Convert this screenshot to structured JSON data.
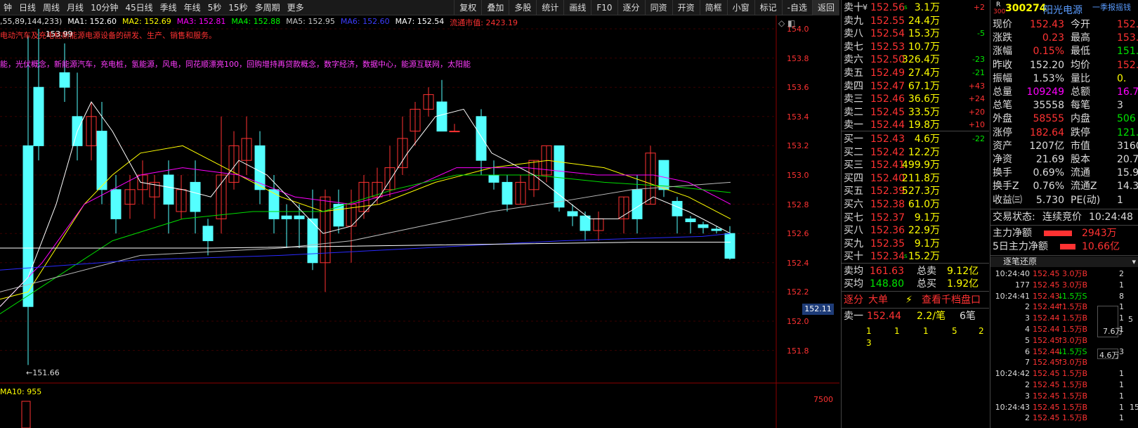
{
  "toolbar": {
    "left": [
      "钟",
      "日线",
      "周线",
      "月线",
      "10分钟",
      "45日线",
      "季线",
      "年线",
      "5秒",
      "15秒",
      "多周期",
      "更多"
    ],
    "right": [
      "复权",
      "叠加",
      "多股",
      "统计",
      "画线",
      "F10",
      "逐分",
      "同资",
      "开资",
      "简框",
      "小窗",
      "标记",
      "-自选",
      "返回"
    ]
  },
  "chart": {
    "ma_prefix": ",55,89,144,233)",
    "ma": [
      {
        "label": "MA1: 152.60",
        "color": "#ffffff"
      },
      {
        "label": "MA2: 152.69",
        "color": "#ffff00"
      },
      {
        "label": "MA3: 152.81",
        "color": "#ff00ff"
      },
      {
        "label": "MA4: 152.88",
        "color": "#00ff00"
      },
      {
        "label": "MA5: 152.95",
        "color": "#c8c8c8"
      },
      {
        "label": "MA6: 152.60",
        "color": "#3c3cff"
      },
      {
        "label": "MA7: 152.54",
        "color": "#ffffff"
      }
    ],
    "market_value": "流通市值: 2423.19",
    "desc1": "电动汽车及充电桩新能源电源设备的研发、生产、销售和服务。",
    "desc2": "能，光伏概念，新能源汽车，充电桩，氢能源，风电，同花顺漂亮100，回购增持再贷款概念，数字经济，数据中心，能源互联网，太阳能",
    "high_label": "153.99",
    "low_label": "←151.66",
    "price_tag": "152.11",
    "vol_label": "MA10: 955",
    "vol_axis": "7500",
    "y_ticks": [
      "154.0",
      "153.8",
      "153.6",
      "153.4",
      "153.2",
      "153.0",
      "152.8",
      "152.6",
      "152.4",
      "152.2",
      "152.0",
      "151.8"
    ]
  },
  "orderbook": {
    "sells": [
      {
        "label": "卖十",
        "flag": "¥",
        "price": "152.56",
        "tag": "s",
        "vol": "3.1万",
        "chg": "+2"
      },
      {
        "label": "卖九",
        "flag": "",
        "price": "152.55",
        "tag": "",
        "vol": "24.4万",
        "chg": ""
      },
      {
        "label": "卖八",
        "flag": "",
        "price": "152.54",
        "tag": "",
        "vol": "15.3万",
        "chg": "-5"
      },
      {
        "label": "卖七",
        "flag": "",
        "price": "152.53",
        "tag": "",
        "vol": "10.7万",
        "chg": ""
      },
      {
        "label": "卖六",
        "flag": "",
        "price": "152.50",
        "tag": "",
        "vol": "326.4万",
        "chg": "-23"
      },
      {
        "label": "卖五",
        "flag": "",
        "price": "152.49",
        "tag": "",
        "vol": "27.4万",
        "chg": "-21"
      },
      {
        "label": "卖四",
        "flag": "",
        "price": "152.47",
        "tag": "",
        "vol": "67.1万",
        "chg": "+43"
      },
      {
        "label": "卖三",
        "flag": "",
        "price": "152.46",
        "tag": "",
        "vol": "36.6万",
        "chg": "+24"
      },
      {
        "label": "卖二",
        "flag": "",
        "price": "152.45",
        "tag": "",
        "vol": "33.5万",
        "chg": "+20"
      },
      {
        "label": "卖一",
        "flag": "",
        "price": "152.44",
        "tag": "",
        "vol": "19.8万",
        "chg": "+10"
      }
    ],
    "buys": [
      {
        "label": "买一",
        "price": "152.43",
        "tag": "",
        "vol": "4.6万",
        "chg": "-22"
      },
      {
        "label": "买二",
        "price": "152.42",
        "tag": "",
        "vol": "12.2万",
        "chg": ""
      },
      {
        "label": "买三",
        "price": "152.41",
        "tag": "",
        "vol": "499.9万",
        "chg": ""
      },
      {
        "label": "买四",
        "price": "152.40",
        "tag": "",
        "vol": "211.8万",
        "chg": ""
      },
      {
        "label": "买五",
        "price": "152.39",
        "tag": "",
        "vol": "527.3万",
        "chg": ""
      },
      {
        "label": "买六",
        "price": "152.38",
        "tag": "",
        "vol": "61.0万",
        "chg": ""
      },
      {
        "label": "买七",
        "price": "152.37",
        "tag": "",
        "vol": "9.1万",
        "chg": ""
      },
      {
        "label": "买八",
        "price": "152.36",
        "tag": "",
        "vol": "22.9万",
        "chg": ""
      },
      {
        "label": "买九",
        "price": "152.35",
        "tag": "",
        "vol": "9.1万",
        "chg": ""
      },
      {
        "label": "买十",
        "price": "152.34",
        "tag": "s",
        "vol": "15.2万",
        "chg": ""
      }
    ],
    "avg_sell_label": "卖均",
    "avg_sell": "161.63",
    "total_sell_label": "总卖",
    "total_sell": "9.12亿",
    "avg_buy_label": "买均",
    "avg_buy": "148.80",
    "total_buy_label": "总买",
    "total_buy": "1.92亿",
    "tabs": [
      "逐分",
      "大单",
      "⚡",
      "查看千档盘口"
    ],
    "sell1_label": "卖一",
    "sell1_price": "152.44",
    "sell1_per": "2.2/笔",
    "sell1_count": "6笔",
    "queue": [
      "1",
      "1",
      "1",
      "5",
      "2",
      "3"
    ]
  },
  "info": {
    "badge": "R",
    "badge_sub": "300",
    "code": "300274",
    "name": "阳光电源",
    "link": "一季报摇钱",
    "rows": [
      [
        "现价",
        "152.43",
        "今开",
        "152."
      ],
      [
        "涨跌",
        "0.23",
        "最高",
        "153."
      ],
      [
        "涨幅",
        "0.15%",
        "最低",
        "151."
      ],
      [
        "昨收",
        "152.20",
        "均价",
        "152."
      ],
      [
        "振幅",
        "1.53%",
        "量比",
        "0."
      ],
      [
        "总量",
        "109249",
        "总额",
        "16.7"
      ],
      [
        "总笔",
        "35558",
        "每笔",
        "3"
      ],
      [
        "外盘",
        "58555",
        "内盘",
        "506"
      ],
      [
        "涨停",
        "182.64",
        "跌停",
        "121."
      ],
      [
        "资产",
        "1207亿",
        "市值",
        "3160"
      ],
      [
        "净资",
        "21.69",
        "股本",
        "20.7"
      ],
      [
        "换手",
        "0.69%",
        "流通",
        "15.9"
      ],
      [
        "换手Z",
        "0.76%",
        "流通Z",
        "14.3"
      ],
      [
        "收益㈢",
        "5.730",
        "PE(动)",
        "1"
      ]
    ],
    "status_label": "交易状态:",
    "status": "连续竞价",
    "time": "10:24:48",
    "main_flow_label": "主力净额",
    "main_flow": "2943万",
    "flow5_label": "5日主力净额",
    "flow5": "10.66亿",
    "ticks_title": "逐笔还原",
    "ticks": [
      [
        "10:24:40",
        "152.45",
        "",
        "3.0万B",
        "2"
      ],
      [
        "177",
        "152.45",
        "",
        "3.0万B",
        "1"
      ],
      [
        "10:24:41",
        "152.43",
        "↓",
        "1.5万S",
        "8"
      ],
      [
        "2",
        "152.44",
        "↑",
        "1.5万B",
        "1"
      ],
      [
        "3",
        "152.44",
        "",
        "1.5万B",
        "1"
      ],
      [
        "4",
        "152.44",
        "",
        "1.5万B",
        "1"
      ],
      [
        "5",
        "152.45",
        "↑",
        "3.0万B",
        ""
      ],
      [
        "6",
        "152.44",
        "↓",
        "1.5万S",
        "3"
      ],
      [
        "7",
        "152.45",
        "↑",
        "3.0万B",
        ""
      ],
      [
        "10:24:42",
        "152.45",
        "",
        "1.5万B",
        "1"
      ],
      [
        "2",
        "152.45",
        "",
        "1.5万B",
        "1"
      ],
      [
        "3",
        "152.45",
        "",
        "1.5万B",
        "1"
      ],
      [
        "10:24:43",
        "152.45",
        "",
        "1.5万B",
        "1"
      ],
      [
        "2",
        "152.45",
        "",
        "1.5万B",
        "1"
      ]
    ],
    "tick_side_a": "5",
    "tick_side_b": "7.6万",
    "tick_side_c": "4.6万",
    "tick_side_d": "15"
  }
}
